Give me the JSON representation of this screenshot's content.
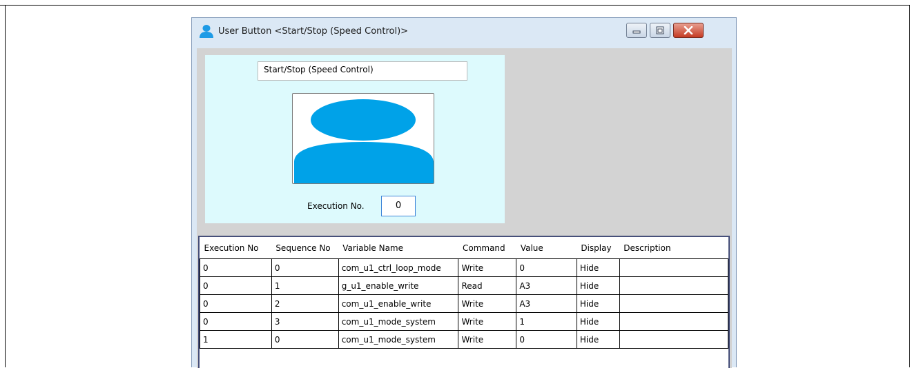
{
  "window": {
    "title": "User Button <Start/Stop (Speed Control)>",
    "icon": "user-icon",
    "controls": [
      "minimize-icon",
      "maximize-icon",
      "close-icon"
    ]
  },
  "button_panel": {
    "name_value": "Start/Stop (Speed Control)",
    "image": "user-silhouette-icon",
    "execution_label": "Execution No.",
    "execution_value": "0"
  },
  "table": {
    "headers": [
      "Execution No",
      "Sequence No",
      "Variable Name",
      "Command",
      "Value",
      "Display",
      "Description"
    ],
    "rows": [
      [
        "0",
        "0",
        "com_u1_ctrl_loop_mode",
        "Write",
        "0",
        "Hide",
        ""
      ],
      [
        "0",
        "1",
        "g_u1_enable_write",
        "Read",
        "A3",
        "Hide",
        ""
      ],
      [
        "0",
        "2",
        "com_u1_enable_write",
        "Write",
        "A3",
        "Hide",
        ""
      ],
      [
        "0",
        "3",
        "com_u1_mode_system",
        "Write",
        "1",
        "Hide",
        ""
      ],
      [
        "1",
        "0",
        "com_u1_mode_system",
        "Write",
        "0",
        "Hide",
        ""
      ]
    ]
  },
  "colors": {
    "accent": "#00a2e8",
    "preview_background": "#ddfafd",
    "client_background": "#d3d3d3",
    "grid_border": "#47507a"
  }
}
